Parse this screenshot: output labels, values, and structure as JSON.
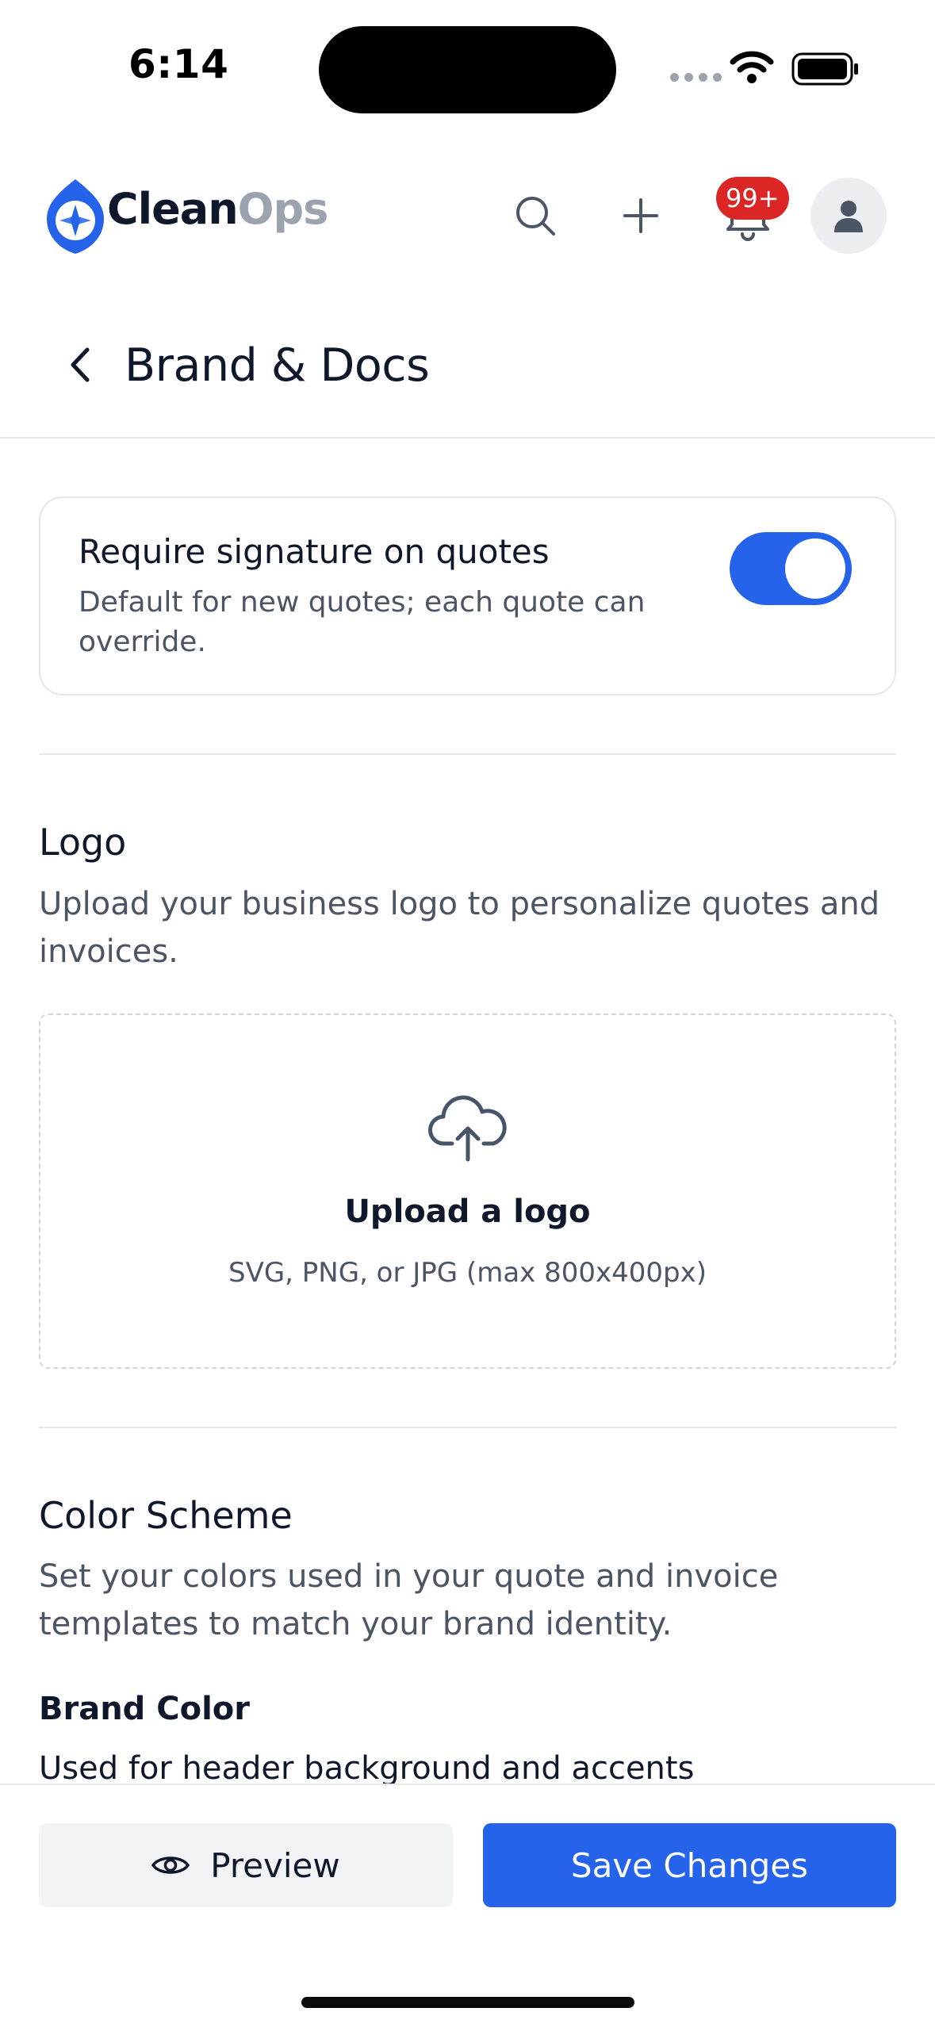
{
  "status_bar": {
    "time": "6:14"
  },
  "header": {
    "brand_part1": "Clean",
    "brand_part2": "Ops",
    "notification_count": "99+",
    "accent_color": "#2563eb",
    "badge_color": "#dc2626"
  },
  "page": {
    "title": "Brand & Docs"
  },
  "signature": {
    "title": "Require signature on quotes",
    "description": "Default for new quotes; each quote can override.",
    "enabled": true
  },
  "logo_section": {
    "title": "Logo",
    "description": "Upload your business logo to personalize quotes and invoices.",
    "upload_title": "Upload a logo",
    "upload_hint": "SVG, PNG, or JPG (max 800x400px)"
  },
  "color_section": {
    "title": "Color Scheme",
    "description": "Set your colors used in your quote and invoice templates to match your brand identity.",
    "brand_color_label": "Brand Color",
    "brand_color_desc": "Used for header background and accents"
  },
  "footer": {
    "preview_label": "Preview",
    "save_label": "Save Changes"
  }
}
